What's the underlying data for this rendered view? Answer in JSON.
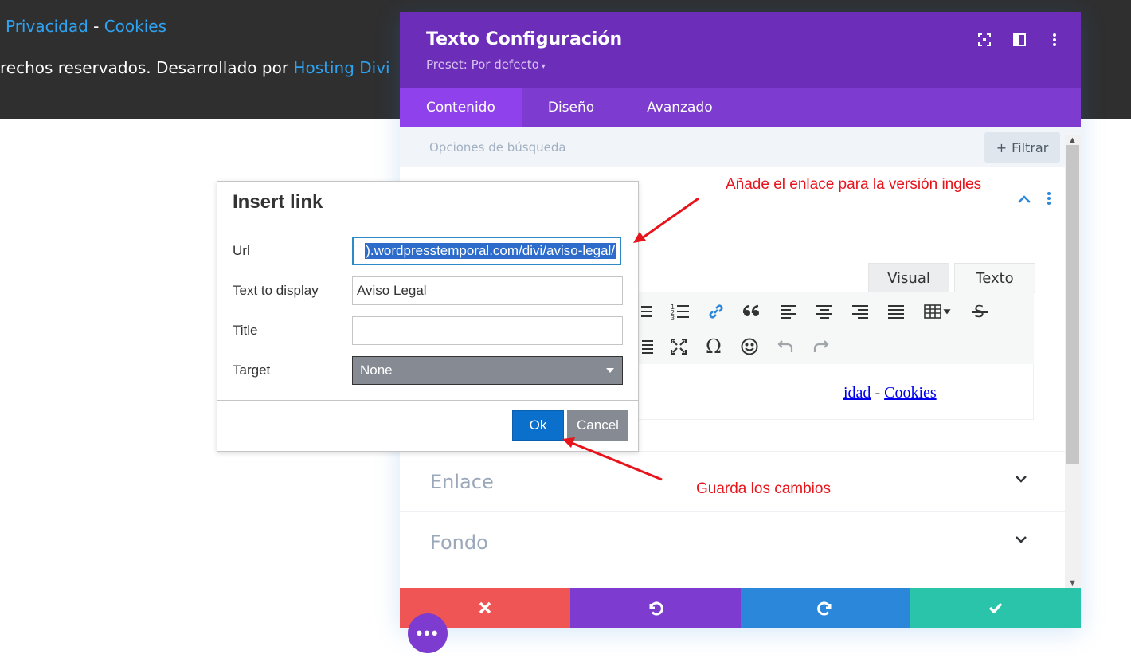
{
  "footer": {
    "link_privacy": "Privacidad",
    "separator": "-",
    "link_cookies": "Cookies",
    "copy_text": "rechos reservados. Desarrollado por",
    "copy_link": "Hosting Divi"
  },
  "modal": {
    "title": "Texto Configuración",
    "preset_label": "Preset: Por defecto",
    "preset_caret": "▾",
    "tabs": [
      {
        "label": "Contenido",
        "active": true
      },
      {
        "label": "Diseño",
        "active": false
      },
      {
        "label": "Avanzado",
        "active": false
      }
    ],
    "search_placeholder": "Opciones de búsqueda",
    "filter_label": "Filtrar",
    "filter_icon": "+",
    "editor_tabs": {
      "visual": "Visual",
      "text": "Texto"
    },
    "editor_content": {
      "link1": "idad",
      "separator": "-",
      "link2": "Cookies"
    },
    "accordions": [
      {
        "label": "Enlace"
      },
      {
        "label": "Fondo"
      }
    ],
    "actions": [
      "cancel-icon",
      "undo-icon",
      "redo-icon",
      "save-icon"
    ]
  },
  "dialog": {
    "title": "Insert link",
    "url_label": "Url",
    "url_value": ").wordpresstemporal.com/divi/aviso-legal/",
    "text_label": "Text to display",
    "text_value": "Aviso Legal",
    "title_label": "Title",
    "title_value": "",
    "target_label": "Target",
    "target_value": "None",
    "ok_label": "Ok",
    "cancel_label": "Cancel"
  },
  "annotations": {
    "top": "Añade el enlace para la versión ingles",
    "bottom": "Guarda los cambios"
  },
  "fab_label": "•••",
  "colors": {
    "header_purple": "#6c2eb9",
    "tab_purple": "#7d3bcf",
    "active_tab": "#8f42ec",
    "cancel_red": "#ef5555",
    "redo_blue": "#2b87da",
    "save_green": "#29c4a9",
    "annotation_red": "#e8141c",
    "ok_blue": "#0b6fcc"
  }
}
